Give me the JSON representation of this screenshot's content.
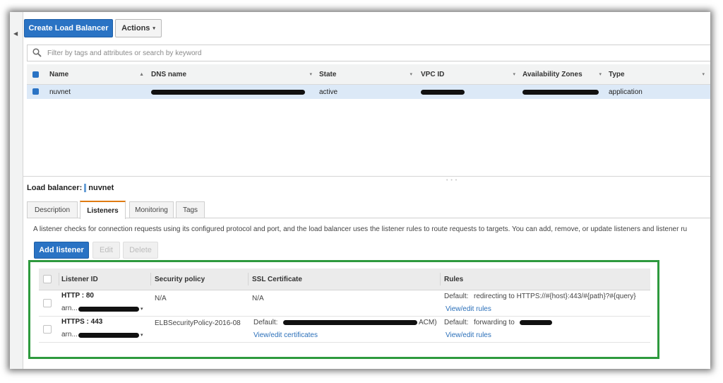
{
  "toolbar": {
    "create_label": "Create Load Balancer",
    "actions_label": "Actions",
    "actions_caret": "▾"
  },
  "search": {
    "placeholder": "Filter by tags and attributes or search by keyword"
  },
  "lb_table": {
    "headers": {
      "name": "Name",
      "dns": "DNS name",
      "state": "State",
      "vpc": "VPC ID",
      "az": "Availability Zones",
      "type": "Type"
    },
    "sort_up": "▲",
    "sort_down": "▾",
    "row": {
      "name": "nuvnet",
      "state": "active",
      "type": "application"
    }
  },
  "details": {
    "label": "Load balancer:",
    "name": "nuvnet",
    "tabs": [
      "Description",
      "Listeners",
      "Monitoring",
      "Tags"
    ],
    "active_tab": "Listeners"
  },
  "listeners": {
    "description": "A listener checks for connection requests using its configured protocol and port, and the load balancer uses the listener rules to route requests to targets. You can add, remove, or update listeners and listener ru",
    "add_label": "Add listener",
    "edit_label": "Edit",
    "delete_label": "Delete",
    "headers": {
      "id": "Listener ID",
      "policy": "Security policy",
      "cert": "SSL Certificate",
      "rules": "Rules"
    },
    "rows": [
      {
        "id": "HTTP : 80",
        "arn_prefix": "arn...",
        "policy": "N/A",
        "cert": "N/A",
        "rule_default": "Default:",
        "rule_text": "redirecting to HTTPS://#{host}:443/#{path}?#{query}",
        "rule_link": "View/edit rules"
      },
      {
        "id": "HTTPS : 443",
        "arn_prefix": "arn...",
        "policy": "ELBSecurityPolicy-2016-08",
        "cert_default": "Default:",
        "cert_suffix": "ACM)",
        "cert_link": "View/edit certificates",
        "rule_default": "Default:",
        "rule_text": "forwarding to",
        "rule_link": "View/edit rules"
      }
    ],
    "caret": "▾"
  },
  "colors": {
    "primary": "#2a73c4",
    "highlight_border": "#2e9a3e",
    "active_tab_accent": "#e07b13",
    "selected_row": "#dce9f7"
  },
  "icons": {
    "search": "search-icon",
    "collapse": "chevron-left-icon",
    "resize": "drag-handle-icon"
  }
}
